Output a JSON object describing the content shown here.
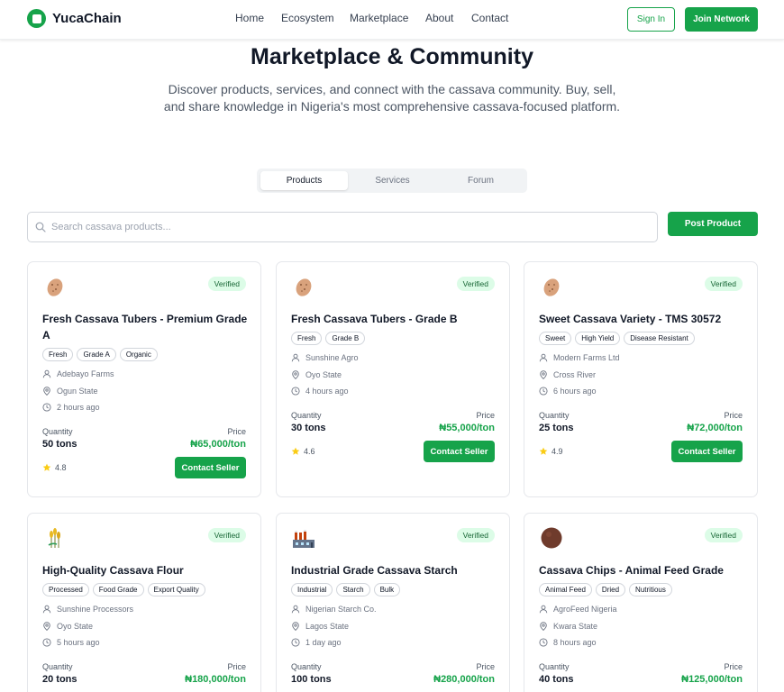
{
  "brand": {
    "name": "YucaChain",
    "accent": "#16a34a"
  },
  "nav": {
    "links": [
      "Home",
      "Ecosystem",
      "Marketplace",
      "About",
      "Contact"
    ],
    "sign_in": "Sign In",
    "join": "Join Network"
  },
  "hero": {
    "title": "Marketplace & Community",
    "subtitle": "Discover products, services, and connect with the cassava community. Buy, sell, and share knowledge in Nigeria's most comprehensive cassava-focused platform."
  },
  "tabs": {
    "items": [
      "Products",
      "Services",
      "Forum"
    ],
    "active": "Products"
  },
  "search": {
    "placeholder": "Search cassava products...",
    "value": ""
  },
  "post_button": "Post Product",
  "labels": {
    "quantity": "Quantity",
    "price": "Price",
    "contact": "Contact Seller",
    "verified": "Verified"
  },
  "products": [
    {
      "icon": "cassava-tuber-icon",
      "title": "Fresh Cassava Tubers - Premium Grade A",
      "tags": [
        "Fresh",
        "Grade A",
        "Organic"
      ],
      "seller": "Adebayo Farms",
      "location": "Ogun State",
      "time": "2 hours ago",
      "quantity": "50 tons",
      "price": "₦65,000/ton",
      "rating": "4.8"
    },
    {
      "icon": "cassava-tuber-icon",
      "title": "Fresh Cassava Tubers - Grade B",
      "tags": [
        "Fresh",
        "Grade B"
      ],
      "seller": "Sunshine Agro",
      "location": "Oyo State",
      "time": "4 hours ago",
      "quantity": "30 tons",
      "price": "₦55,000/ton",
      "rating": "4.6"
    },
    {
      "icon": "cassava-tuber-icon",
      "title": "Sweet Cassava Variety - TMS 30572",
      "tags": [
        "Sweet",
        "High Yield",
        "Disease Resistant"
      ],
      "seller": "Modern Farms Ltd",
      "location": "Cross River",
      "time": "6 hours ago",
      "quantity": "25 tons",
      "price": "₦72,000/ton",
      "rating": "4.9"
    },
    {
      "icon": "wheat-icon",
      "title": "High-Quality Cassava Flour",
      "tags": [
        "Processed",
        "Food Grade",
        "Export Quality"
      ],
      "seller": "Sunshine Processors",
      "location": "Oyo State",
      "time": "5 hours ago",
      "quantity": "20 tons",
      "price": "₦180,000/ton"
    },
    {
      "icon": "factory-icon",
      "title": "Industrial Grade Cassava Starch",
      "tags": [
        "Industrial",
        "Starch",
        "Bulk"
      ],
      "seller": "Nigerian Starch Co.",
      "location": "Lagos State",
      "time": "1 day ago",
      "quantity": "100 tons",
      "price": "₦280,000/ton"
    },
    {
      "icon": "chip-icon",
      "title": "Cassava Chips - Animal Feed Grade",
      "tags": [
        "Animal Feed",
        "Dried",
        "Nutritious"
      ],
      "seller": "AgroFeed Nigeria",
      "location": "Kwara State",
      "time": "8 hours ago",
      "quantity": "40 tons",
      "price": "₦125,000/ton"
    }
  ]
}
